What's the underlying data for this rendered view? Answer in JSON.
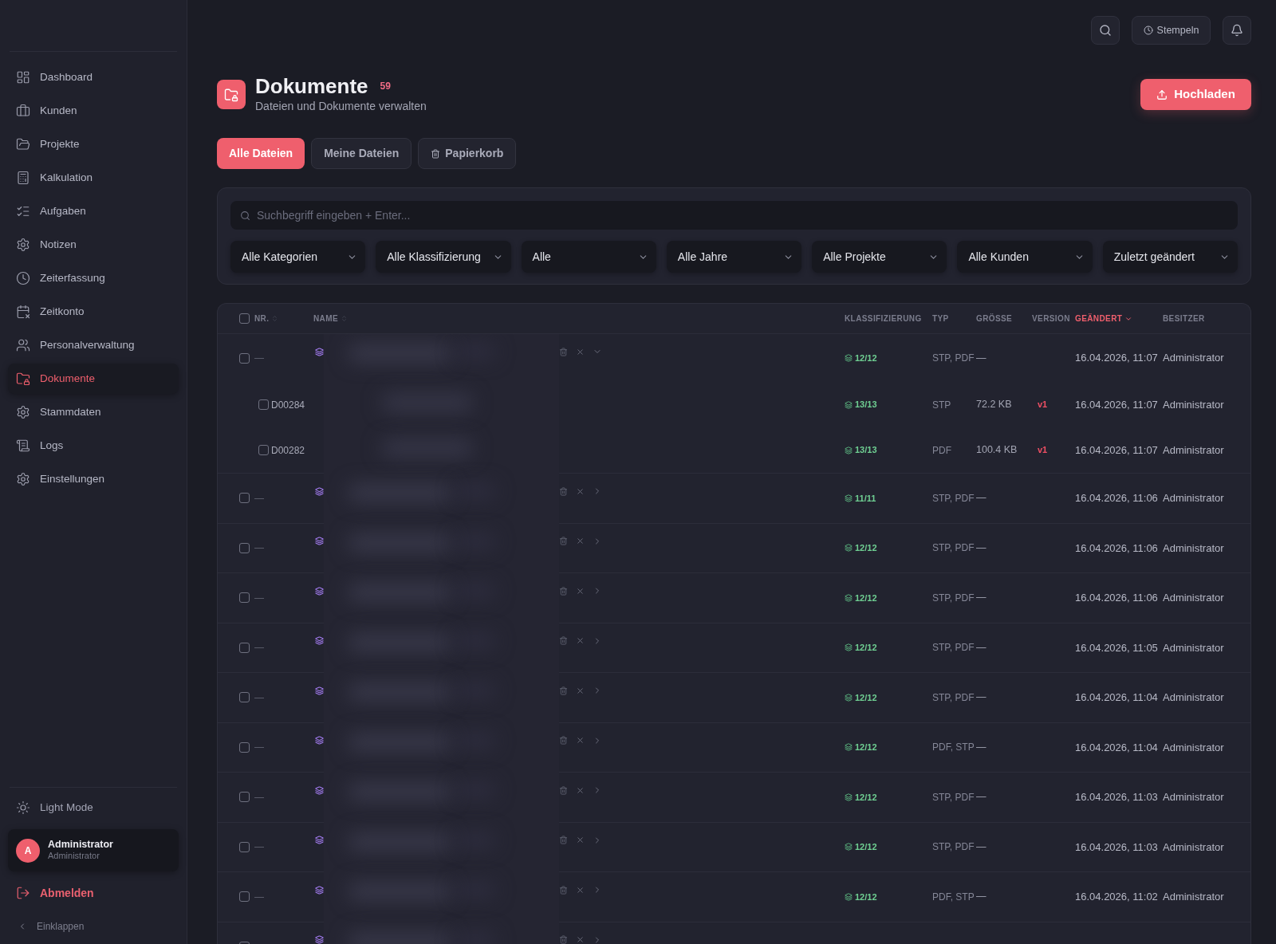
{
  "sidebar": {
    "items": [
      {
        "label": "Dashboard",
        "selected": false
      },
      {
        "label": "Kunden",
        "selected": false
      },
      {
        "label": "Projekte",
        "selected": false
      },
      {
        "label": "Kalkulation",
        "selected": false
      },
      {
        "label": "Aufgaben",
        "selected": false
      },
      {
        "label": "Notizen",
        "selected": false
      },
      {
        "label": "Zeiterfassung",
        "selected": false
      },
      {
        "label": "Zeitkonto",
        "selected": false
      },
      {
        "label": "Personalverwaltung",
        "selected": false
      },
      {
        "label": "Dokumente",
        "selected": true
      },
      {
        "label": "Stammdaten",
        "selected": false
      },
      {
        "label": "Logs",
        "selected": false
      },
      {
        "label": "Einstellungen",
        "selected": false
      }
    ],
    "theme_toggle": "Light Mode",
    "user": {
      "initial": "A",
      "name": "Administrator",
      "role": "Administrator"
    },
    "logout": "Abmelden",
    "collapse": "Einklappen"
  },
  "topbar": {
    "stamp_button": "Stempeln"
  },
  "header": {
    "title": "Dokumente",
    "count": "59",
    "subtitle": "Dateien und Dokumente verwalten",
    "upload_button": "Hochladen"
  },
  "tabs": [
    {
      "label": "Alle Dateien",
      "selected": true
    },
    {
      "label": "Meine Dateien",
      "selected": false
    },
    {
      "label": "Papierkorb",
      "selected": false
    }
  ],
  "filters": {
    "search": {
      "placeholder": "Suchbegriff eingeben + Enter..."
    },
    "dropdowns": [
      "Alle Kategorien",
      "Alle Klassifizierung",
      "Alle",
      "Alle Jahre",
      "Alle Projekte",
      "Alle Kunden",
      "Zuletzt geändert"
    ]
  },
  "table": {
    "header_checkbox": {
      "checked": false
    },
    "columns": [
      {
        "label": "NR.",
        "sortable": true,
        "sorted": false
      },
      {
        "label": "NAME",
        "sortable": true,
        "sorted": false
      },
      {
        "label": "KLASSIFIZIERUNG",
        "sortable": false,
        "sorted": false
      },
      {
        "label": "TYP",
        "sortable": false,
        "sorted": false
      },
      {
        "label": "GRÖSSE",
        "sortable": false,
        "sorted": false
      },
      {
        "label": "VERSION",
        "sortable": false,
        "sorted": false
      },
      {
        "label": "GEÄNDERT",
        "sortable": true,
        "sorted": true
      },
      {
        "label": "BESITZER",
        "sortable": false,
        "sorted": false
      }
    ],
    "rows": [
      {
        "number": "—",
        "classification": "12/12",
        "types": "STP, PDF",
        "size": "—",
        "modified": "16.04.2026, 11:07",
        "owner": "Administrator",
        "checked": false,
        "expanded": true,
        "children": [
          {
            "number": "D00284",
            "classification": "13/13",
            "types": "STP",
            "size": "72.2 KB",
            "version": "v1",
            "modified": "16.04.2026, 11:07",
            "owner": "Administrator",
            "checked": false
          },
          {
            "number": "D00282",
            "classification": "13/13",
            "types": "PDF",
            "size": "100.4 KB",
            "version": "v1",
            "modified": "16.04.2026, 11:07",
            "owner": "Administrator",
            "checked": false
          }
        ]
      },
      {
        "number": "—",
        "classification": "11/11",
        "types": "STP, PDF",
        "size": "—",
        "modified": "16.04.2026, 11:06",
        "owner": "Administrator",
        "checked": false,
        "expanded": false
      },
      {
        "number": "—",
        "classification": "12/12",
        "types": "STP, PDF",
        "size": "—",
        "modified": "16.04.2026, 11:06",
        "owner": "Administrator",
        "checked": false,
        "expanded": false
      },
      {
        "number": "—",
        "classification": "12/12",
        "types": "STP, PDF",
        "size": "—",
        "modified": "16.04.2026, 11:06",
        "owner": "Administrator",
        "checked": false,
        "expanded": false
      },
      {
        "number": "—",
        "classification": "12/12",
        "types": "STP, PDF",
        "size": "—",
        "modified": "16.04.2026, 11:05",
        "owner": "Administrator",
        "checked": false,
        "expanded": false
      },
      {
        "number": "—",
        "classification": "12/12",
        "types": "STP, PDF",
        "size": "—",
        "modified": "16.04.2026, 11:04",
        "owner": "Administrator",
        "checked": false,
        "expanded": false
      },
      {
        "number": "—",
        "classification": "12/12",
        "types": "PDF, STP",
        "size": "—",
        "modified": "16.04.2026, 11:04",
        "owner": "Administrator",
        "checked": false,
        "expanded": false
      },
      {
        "number": "—",
        "classification": "12/12",
        "types": "STP, PDF",
        "size": "—",
        "modified": "16.04.2026, 11:03",
        "owner": "Administrator",
        "checked": false,
        "expanded": false
      },
      {
        "number": "—",
        "classification": "12/12",
        "types": "STP, PDF",
        "size": "—",
        "modified": "16.04.2026, 11:03",
        "owner": "Administrator",
        "checked": false,
        "expanded": false
      },
      {
        "number": "—",
        "classification": "12/12",
        "types": "PDF, STP",
        "size": "—",
        "modified": "16.04.2026, 11:02",
        "owner": "Administrator",
        "checked": false,
        "expanded": false
      },
      {
        "checked": false,
        "expanded": false
      }
    ]
  }
}
